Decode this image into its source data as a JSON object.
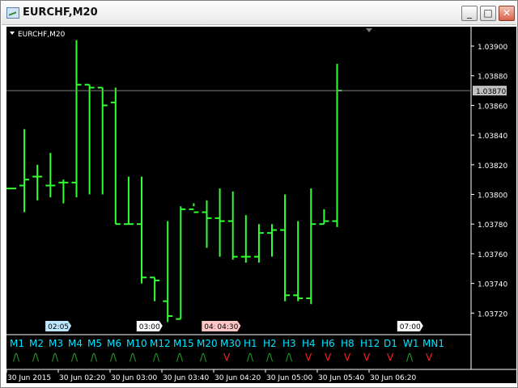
{
  "window": {
    "title": "EURCHF,M20",
    "minimize": "_",
    "maximize": "□",
    "close": "✕"
  },
  "chart_label": "EURCHF,M20",
  "current_price": "1.03870",
  "chart_data": {
    "type": "bar",
    "symbol": "EURCHF,M20",
    "ylim": [
      1.03706,
      1.03912
    ],
    "grid": false,
    "price_ticks": [
      "1.03900",
      "1.03880",
      "1.03860",
      "1.03840",
      "1.03820",
      "1.03800",
      "1.03780",
      "1.03760",
      "1.03740",
      "1.03720"
    ],
    "ohlc": [
      {
        "o": 1.03804,
        "h": 1.03804,
        "l": 1.03804,
        "c": 1.03804
      },
      {
        "o": 1.03806,
        "h": 1.03844,
        "l": 1.03788,
        "c": 1.0381
      },
      {
        "o": 1.03812,
        "h": 1.0382,
        "l": 1.03796,
        "c": 1.03812
      },
      {
        "o": 1.03806,
        "h": 1.03828,
        "l": 1.03798,
        "c": 1.03806
      },
      {
        "o": 1.03808,
        "h": 1.0381,
        "l": 1.03794,
        "c": 1.03808
      },
      {
        "o": 1.03808,
        "h": 1.03904,
        "l": 1.03798,
        "c": 1.03874
      },
      {
        "o": 1.03874,
        "h": 1.03874,
        "l": 1.038,
        "c": 1.03872
      },
      {
        "o": 1.03872,
        "h": 1.03872,
        "l": 1.038,
        "c": 1.0386
      },
      {
        "o": 1.03862,
        "h": 1.03872,
        "l": 1.0378,
        "c": 1.0378
      },
      {
        "o": 1.0378,
        "h": 1.03812,
        "l": 1.0378,
        "c": 1.0378
      },
      {
        "o": 1.0378,
        "h": 1.03812,
        "l": 1.0374,
        "c": 1.03744
      },
      {
        "o": 1.03744,
        "h": 1.03744,
        "l": 1.03728,
        "c": 1.03742
      },
      {
        "o": 1.03728,
        "h": 1.03782,
        "l": 1.03714,
        "c": 1.03718
      },
      {
        "o": 1.03716,
        "h": 1.03792,
        "l": 1.03716,
        "c": 1.0379
      },
      {
        "o": 1.0379,
        "h": 1.03792,
        "l": 1.03794,
        "c": 1.03788
      },
      {
        "o": 1.03788,
        "h": 1.03796,
        "l": 1.03764,
        "c": 1.03784
      },
      {
        "o": 1.03784,
        "h": 1.03804,
        "l": 1.03758,
        "c": 1.03782
      },
      {
        "o": 1.03782,
        "h": 1.03802,
        "l": 1.03756,
        "c": 1.03758
      },
      {
        "o": 1.03758,
        "h": 1.03786,
        "l": 1.03754,
        "c": 1.03758
      },
      {
        "o": 1.03758,
        "h": 1.0378,
        "l": 1.03754,
        "c": 1.03774
      },
      {
        "o": 1.03774,
        "h": 1.0378,
        "l": 1.03758,
        "c": 1.03776
      },
      {
        "o": 1.03776,
        "h": 1.038,
        "l": 1.03728,
        "c": 1.03732
      },
      {
        "o": 1.03732,
        "h": 1.03782,
        "l": 1.03728,
        "c": 1.0373
      },
      {
        "o": 1.0373,
        "h": 1.03804,
        "l": 1.03726,
        "c": 1.0378
      },
      {
        "o": 1.0378,
        "h": 1.0379,
        "l": 1.0378,
        "c": 1.03782
      },
      {
        "o": 1.03782,
        "h": 1.03888,
        "l": 1.03778,
        "c": 1.0387
      }
    ],
    "session_labels": [
      {
        "bar": 1,
        "text": "02:05",
        "color": "#bfe7ff"
      },
      {
        "bar": 8,
        "text": "03:00",
        "color": "#ffffff"
      },
      {
        "bar": 13,
        "text": "04:00",
        "color": "#ffc8c8"
      },
      {
        "bar": 14,
        "text": "04:30",
        "color": "#ffc8c8"
      },
      {
        "bar": 28,
        "text": "07:00",
        "color": "#ffffff"
      }
    ],
    "timeframes": [
      {
        "label": "M1",
        "signal": "/\\",
        "dir": "up"
      },
      {
        "label": "M2",
        "signal": "/\\",
        "dir": "up"
      },
      {
        "label": "M3",
        "signal": "/\\",
        "dir": "up"
      },
      {
        "label": "M4",
        "signal": "/\\",
        "dir": "up"
      },
      {
        "label": "M5",
        "signal": "/\\",
        "dir": "up"
      },
      {
        "label": "M6",
        "signal": "/\\",
        "dir": "up"
      },
      {
        "label": "M10",
        "signal": "/\\",
        "dir": "up"
      },
      {
        "label": "M12",
        "signal": "/\\",
        "dir": "up"
      },
      {
        "label": "M15",
        "signal": "/\\",
        "dir": "up"
      },
      {
        "label": "M20",
        "signal": "/\\",
        "dir": "up"
      },
      {
        "label": "M30",
        "signal": "V",
        "dir": "down"
      },
      {
        "label": "H1",
        "signal": "/\\",
        "dir": "up"
      },
      {
        "label": "H2",
        "signal": "/\\",
        "dir": "up"
      },
      {
        "label": "H3",
        "signal": "/\\",
        "dir": "up"
      },
      {
        "label": "H4",
        "signal": "V",
        "dir": "down"
      },
      {
        "label": "H6",
        "signal": "V",
        "dir": "down"
      },
      {
        "label": "H8",
        "signal": "V",
        "dir": "down"
      },
      {
        "label": "H12",
        "signal": "V",
        "dir": "down"
      },
      {
        "label": "D1",
        "signal": "V",
        "dir": "down"
      },
      {
        "label": "W1",
        "signal": "/\\",
        "dir": "up"
      },
      {
        "label": "MN1",
        "signal": "V",
        "dir": "down"
      }
    ],
    "time_ticks": [
      "30 Jun 2015",
      "30 Jun 02:20",
      "30 Jun 03:00",
      "30 Jun 03:40",
      "30 Jun 04:20",
      "30 Jun 05:00",
      "30 Jun 05:40",
      "30 Jun 06:20"
    ]
  },
  "colors": {
    "bar": "#33ff33",
    "label_text": "#00e5ff",
    "up_signal": "#22aa22",
    "down_signal": "#ff2020",
    "axis_text": "#ffffff",
    "bid_line": "#808080"
  }
}
